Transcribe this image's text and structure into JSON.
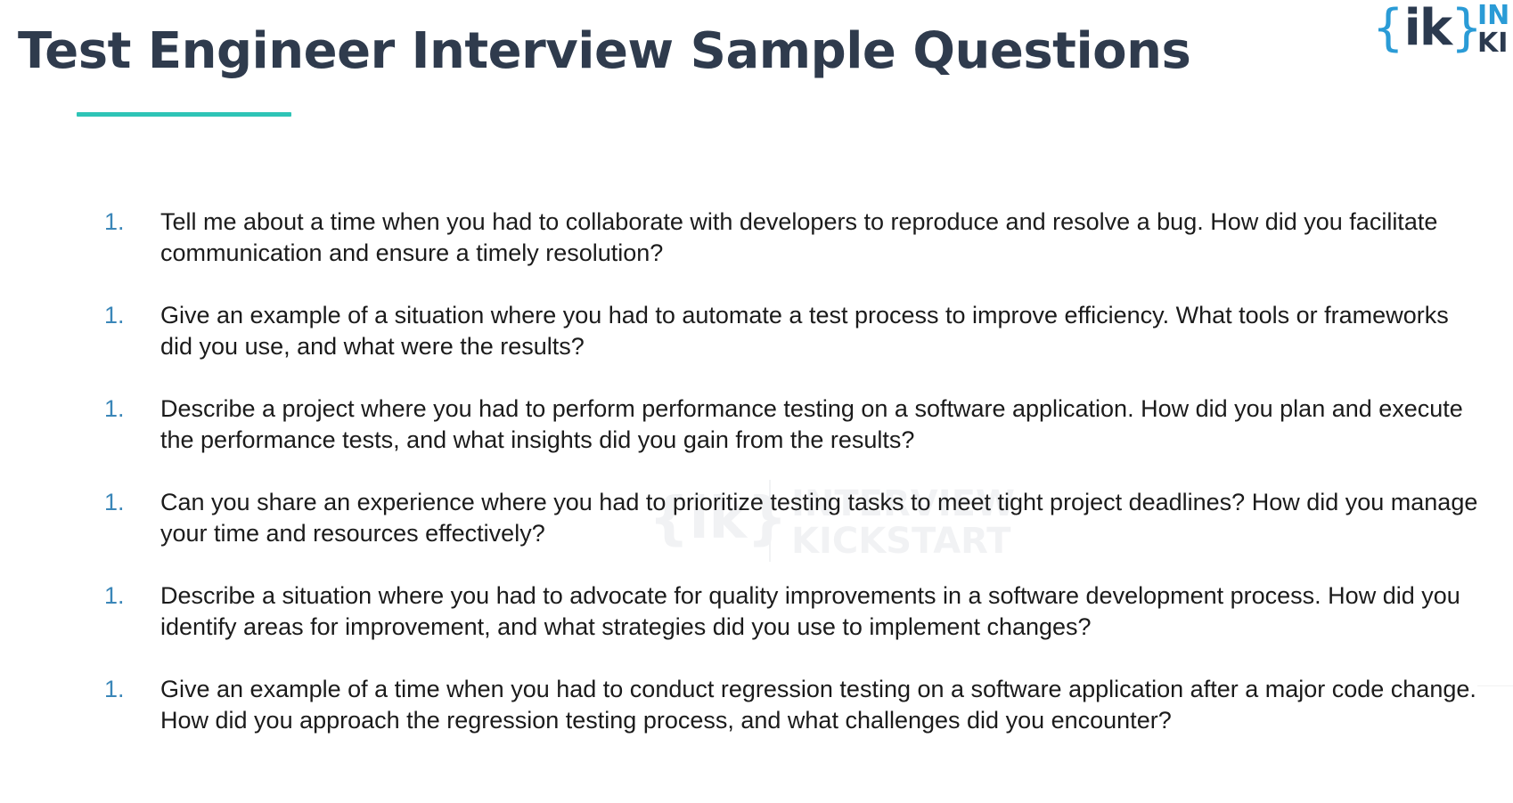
{
  "slide": {
    "title": "Test Engineer Interview Sample Questions"
  },
  "logo": {
    "brace_open": "{",
    "mark": "ik",
    "brace_close": "}",
    "text_line1": "IN",
    "text_line2": "KI"
  },
  "watermark": {
    "mark": "{ik}",
    "line1": "INTERVIEW",
    "line2": "KICKSTART"
  },
  "questions": [
    {
      "number": "1.",
      "text": "Tell me about a time when you had to collaborate with developers to reproduce and resolve a bug. How did you facilitate communication and ensure a timely resolution?"
    },
    {
      "number": "1.",
      "text": "Give an example of a situation where you had to automate a test process to improve efficiency. What tools or frameworks did you use, and what were the results?"
    },
    {
      "number": "1.",
      "text": "Describe a project where you had to perform performance testing on a software application. How did you plan and execute the performance tests, and what insights did you gain from the results?"
    },
    {
      "number": "1.",
      "text": "Can you share an experience where you had to prioritize testing tasks to meet tight project deadlines? How did you manage your time and resources effectively?"
    },
    {
      "number": "1.",
      "text": "Describe a situation where you had to advocate for quality improvements in a software development process. How did you identify areas for improvement, and what strategies did you use to implement changes?"
    },
    {
      "number": "1.",
      "text": "Give an example of a time when you had to conduct regression testing on a software application after a major code change. How did you approach the regression testing process, and what challenges did you encounter?"
    }
  ],
  "colors": {
    "title": "#2f3b4d",
    "accent_underline": "#2ec4b6",
    "list_number": "#3a86b8",
    "logo_blue": "#2a9bd6",
    "logo_dark": "#2b3a4f"
  }
}
